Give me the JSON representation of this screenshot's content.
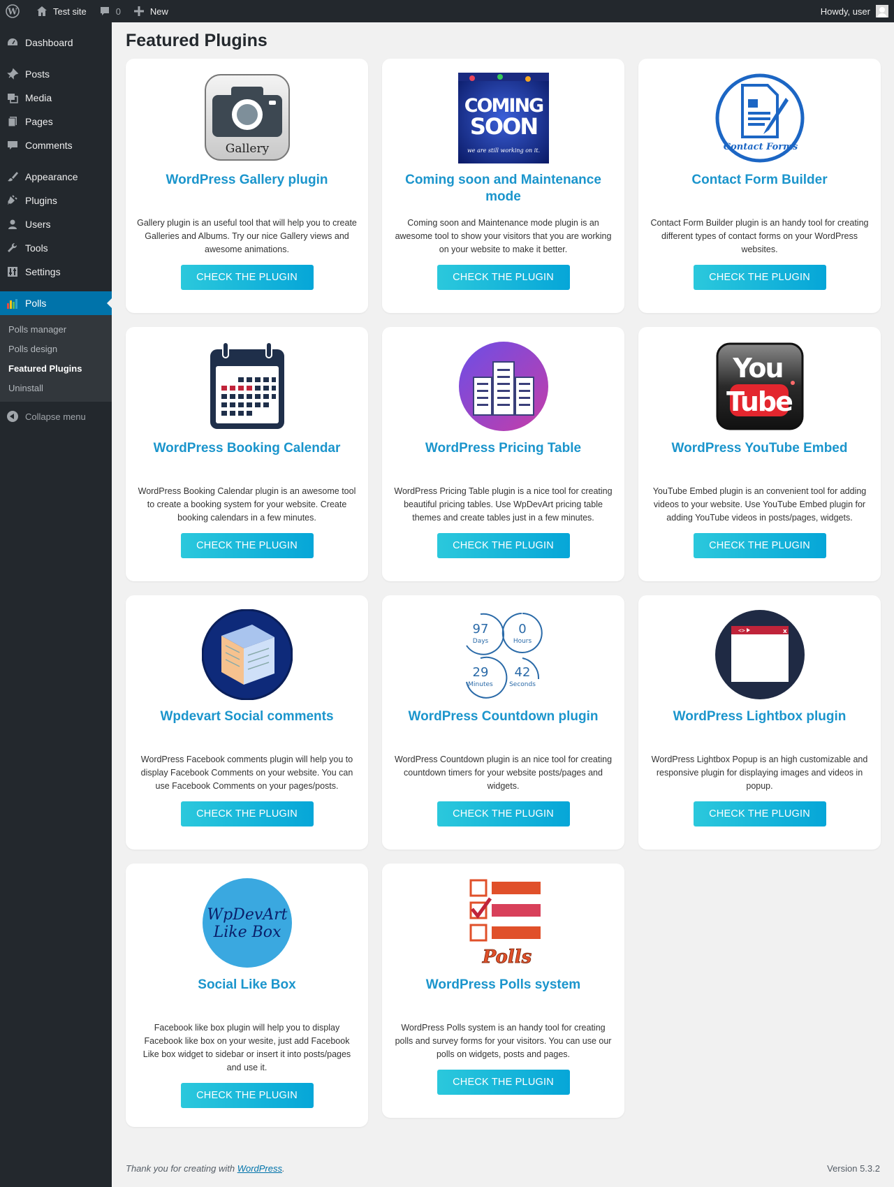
{
  "adminbar": {
    "site_name": "Test site",
    "comments_count": "0",
    "new_label": "New",
    "howdy": "Howdy, user"
  },
  "sidebar": {
    "items": [
      {
        "label": "Dashboard",
        "icon": "dashboard-icon"
      },
      {
        "label": "Posts",
        "icon": "pin-icon"
      },
      {
        "label": "Media",
        "icon": "media-icon"
      },
      {
        "label": "Pages",
        "icon": "pages-icon"
      },
      {
        "label": "Comments",
        "icon": "comment-icon"
      },
      {
        "label": "Appearance",
        "icon": "brush-icon"
      },
      {
        "label": "Plugins",
        "icon": "plug-icon"
      },
      {
        "label": "Users",
        "icon": "user-icon"
      },
      {
        "label": "Tools",
        "icon": "wrench-icon"
      },
      {
        "label": "Settings",
        "icon": "settings-icon"
      },
      {
        "label": "Polls",
        "icon": "bar-chart-icon"
      }
    ],
    "submenu": [
      "Polls manager",
      "Polls design",
      "Featured Plugins",
      "Uninstall"
    ],
    "collapse_label": "Collapse menu"
  },
  "page": {
    "title": "Featured Plugins",
    "button_label": "CHECK THE PLUGIN"
  },
  "plugins": [
    {
      "title": "WordPress Gallery plugin",
      "desc": "Gallery plugin is an useful tool that will help you to create Galleries and Albums. Try our nice Gallery views and awesome animations.",
      "icon_text": "Gallery"
    },
    {
      "title": "Coming soon and Maintenance mode",
      "desc": "Coming soon and Maintenance mode plugin is an awesome tool to show your visitors that you are working on your website to make it better.",
      "icon_text": "COMING SOON",
      "icon_sub": "we are still working on it."
    },
    {
      "title": "Contact Form Builder",
      "desc": "Contact Form Builder plugin is an handy tool for creating different types of contact forms on your WordPress websites.",
      "icon_text": "Contact Forms"
    },
    {
      "title": "WordPress Booking Calendar",
      "desc": "WordPress Booking Calendar plugin is an awesome tool to create a booking system for your website. Create booking calendars in a few minutes."
    },
    {
      "title": "WordPress Pricing Table",
      "desc": "WordPress Pricing Table plugin is a nice tool for creating beautiful pricing tables. Use WpDevArt pricing table themes and create tables just in a few minutes."
    },
    {
      "title": "WordPress YouTube Embed",
      "desc": "YouTube Embed plugin is an convenient tool for adding videos to your website. Use YouTube Embed plugin for adding YouTube videos in posts/pages, widgets.",
      "icon_text_1": "You",
      "icon_text_2": "Tube"
    },
    {
      "title": "Wpdevart Social comments",
      "desc": "WordPress Facebook comments plugin will help you to display Facebook Comments on your website. You can use Facebook Comments on your pages/posts."
    },
    {
      "title": "WordPress Countdown plugin",
      "desc": "WordPress Countdown plugin is an nice tool for creating countdown timers for your website posts/pages and widgets.",
      "countdown": [
        {
          "n": "97",
          "u": "Days"
        },
        {
          "n": "0",
          "u": "Hours"
        },
        {
          "n": "29",
          "u": "Minutes"
        },
        {
          "n": "42",
          "u": "Seconds"
        }
      ]
    },
    {
      "title": "WordPress Lightbox plugin",
      "desc": "WordPress Lightbox Popup is an high customizable and responsive plugin for displaying images and videos in popup."
    },
    {
      "title": "Social Like Box",
      "desc": "Facebook like box plugin will help you to display Facebook like box on your wesite, just add Facebook Like box widget to sidebar or insert it into posts/pages and use it.",
      "icon_text_1": "WpDevArt",
      "icon_text_2": "Like Box"
    },
    {
      "title": "WordPress Polls system",
      "desc": "WordPress Polls system is an handy tool for creating polls and survey forms for your visitors. You can use our polls on widgets, posts and pages.",
      "icon_text": "Polls"
    }
  ],
  "footer": {
    "thanks_prefix": "Thank you for creating with ",
    "wp_link": "WordPress",
    "thanks_suffix": ".",
    "version": "Version 5.3.2"
  },
  "colors": {
    "accent": "#0073aa",
    "title_blue": "#1b95cc",
    "button_start": "#2bc8dc",
    "button_end": "#06a6d8"
  }
}
